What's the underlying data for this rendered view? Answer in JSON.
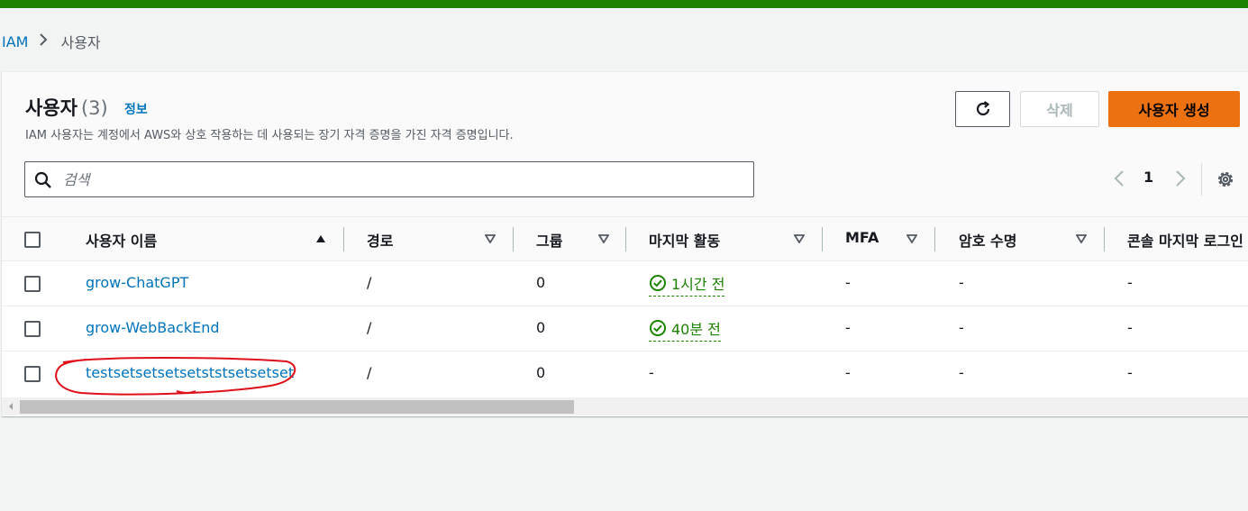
{
  "breadcrumb": {
    "root": "IAM",
    "current": "사용자"
  },
  "header": {
    "title": "사용자",
    "count": "(3)",
    "info_link": "정보",
    "description": "IAM 사용자는 계정에서 AWS와 상호 작용하는 데 사용되는 장기 자격 증명을 가진 자격 증명입니다."
  },
  "actions": {
    "delete_label": "삭제",
    "create_label": "사용자 생성"
  },
  "search": {
    "placeholder": "검색",
    "value": ""
  },
  "pagination": {
    "current_page": "1"
  },
  "columns": [
    "사용자 이름",
    "경로",
    "그룹",
    "마지막 활동",
    "MFA",
    "암호 수명",
    "콘솔 마지막 로그인"
  ],
  "rows": [
    {
      "name": "grow-ChatGPT",
      "path": "/",
      "groups": "0",
      "last_activity": "1시간 전",
      "mfa": "-",
      "password_age": "-",
      "console_last_login": "-"
    },
    {
      "name": "grow-WebBackEnd",
      "path": "/",
      "groups": "0",
      "last_activity": "40분 전",
      "mfa": "-",
      "password_age": "-",
      "console_last_login": "-"
    },
    {
      "name": "testsetsetsetsetststsetsetset",
      "path": "/",
      "groups": "0",
      "last_activity": "-",
      "mfa": "-",
      "password_age": "-",
      "console_last_login": "-"
    }
  ],
  "colors": {
    "top_bar": "#1d8102",
    "link": "#0073bb",
    "primary_button": "#ec7211",
    "success": "#1d8102",
    "annotation": "#e0101a"
  },
  "icons": [
    "chevron-right-icon",
    "refresh-icon",
    "search-icon",
    "chevron-left-icon",
    "gear-icon",
    "sort-ascending-icon",
    "sort-descending-icon",
    "check-circle-icon"
  ]
}
